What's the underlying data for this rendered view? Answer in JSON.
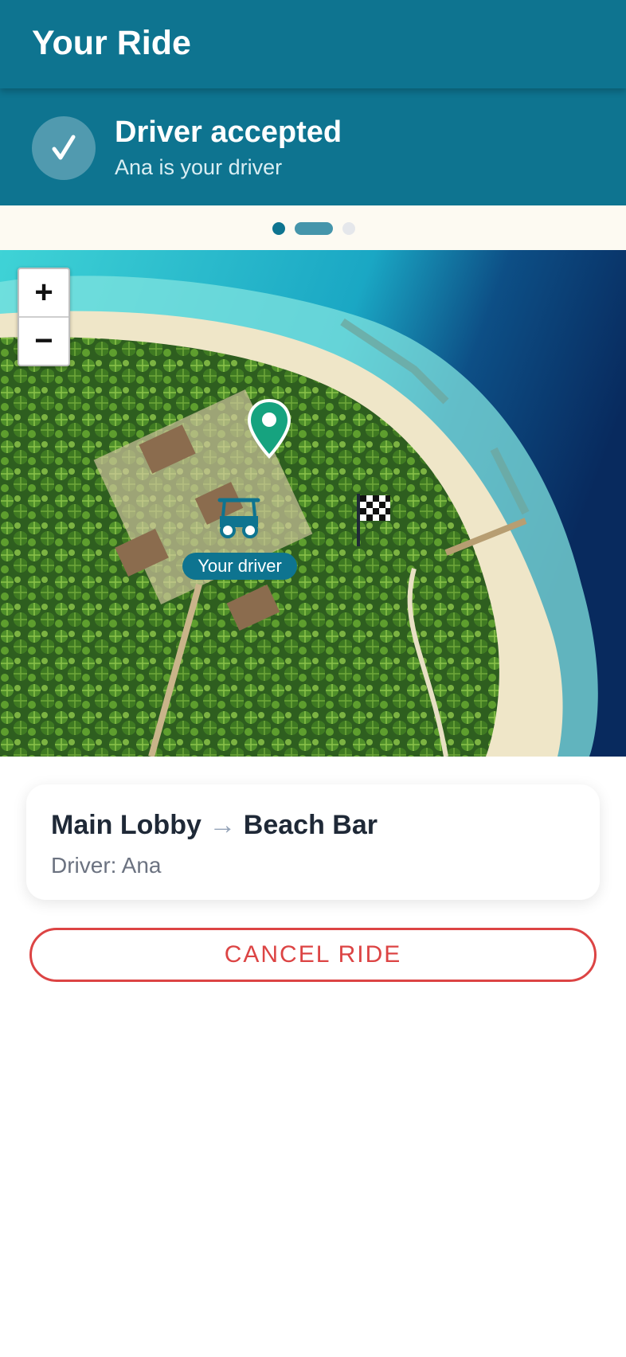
{
  "header": {
    "title": "Your Ride"
  },
  "status": {
    "icon": "check-icon",
    "title": "Driver accepted",
    "subtitle": "Ana is your driver"
  },
  "progress": {
    "steps": 3,
    "current_step": 2,
    "colors": {
      "done": "#0e7490",
      "active": "#4595ab",
      "pending": "#e5e7eb"
    }
  },
  "map": {
    "zoom_in_label": "+",
    "zoom_out_label": "−",
    "pickup_marker_icon": "map-pin-icon",
    "driver_icon": "golf-cart-icon",
    "driver_label": "Your driver",
    "destination_icon": "checkered-flag-icon"
  },
  "ride": {
    "from": "Main Lobby",
    "arrow": "→",
    "to": "Beach Bar",
    "driver_text": "Driver: Ana"
  },
  "actions": {
    "cancel_label": "CANCEL RIDE"
  },
  "colors": {
    "primary": "#0e7490",
    "danger": "#dc4444",
    "pin": "#16a37f"
  }
}
